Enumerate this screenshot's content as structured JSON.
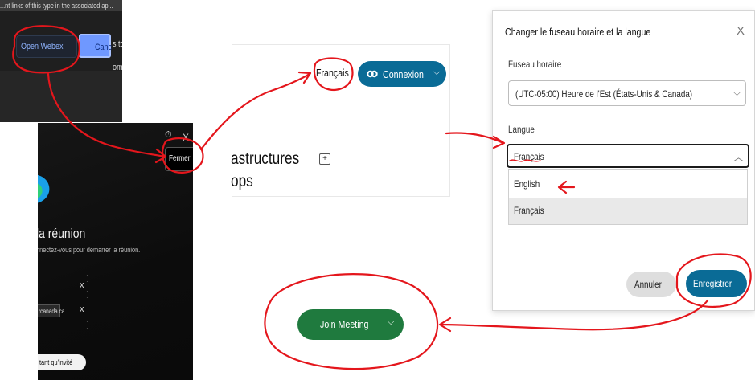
{
  "top_dialog": {
    "header_text": "...nt links of this type in the associated ap...",
    "open_button": "Open Webex",
    "cancel_button": "Canc",
    "side_text_1": "s to",
    "side_text_2": "om t"
  },
  "meeting_panel": {
    "close_button": "Fermer",
    "close_x": "X",
    "title": "la réunion",
    "subtitle": "nnectez-vous pour demarrer la réunion.",
    "field_x_1": "x",
    "field_tag": "rcanada.ca",
    "field_x_2": "x",
    "invite_pill": "tant qu'invité"
  },
  "site_header": {
    "language_link": "Français",
    "connexion_button": "Connexion",
    "heading_line_1": "astructures",
    "heading_line_2": "ops"
  },
  "modal": {
    "title": "Changer le fuseau horaire et la langue",
    "close": "X",
    "timezone_label": "Fuseau horaire",
    "timezone_value": "(UTC-05:00) Heure de l'Est (États-Unis & Canada)",
    "language_label": "Langue",
    "language_value": "Français",
    "options": [
      "English",
      "Français"
    ],
    "cancel_button": "Annuler",
    "save_button": "Enregistrer"
  },
  "join_button": {
    "label": "Join Meeting"
  },
  "colors": {
    "webex_blue": "#0a6b96",
    "join_green": "#1f7a3e",
    "annotation_red": "#e4161c"
  }
}
